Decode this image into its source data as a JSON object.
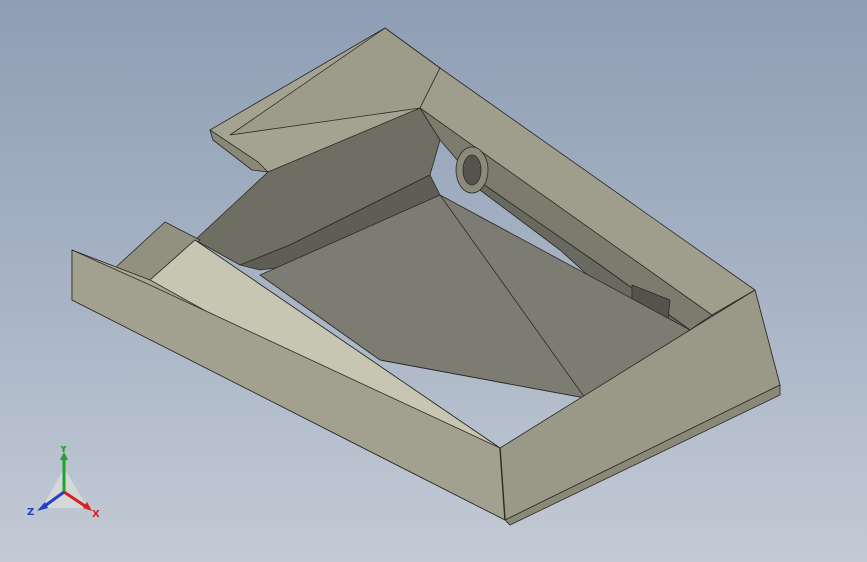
{
  "viewport": {
    "background_top": "#8f9eb5",
    "background_bottom": "#c3cad5"
  },
  "model": {
    "name": "tray-part",
    "face_color": "#9e9c8a",
    "edge_color": "#2b2a24"
  },
  "triad": {
    "x_label": "X",
    "y_label": "Y",
    "z_label": "Z",
    "x_color": "#d42020",
    "y_color": "#1fa32a",
    "z_color": "#2140c8"
  }
}
